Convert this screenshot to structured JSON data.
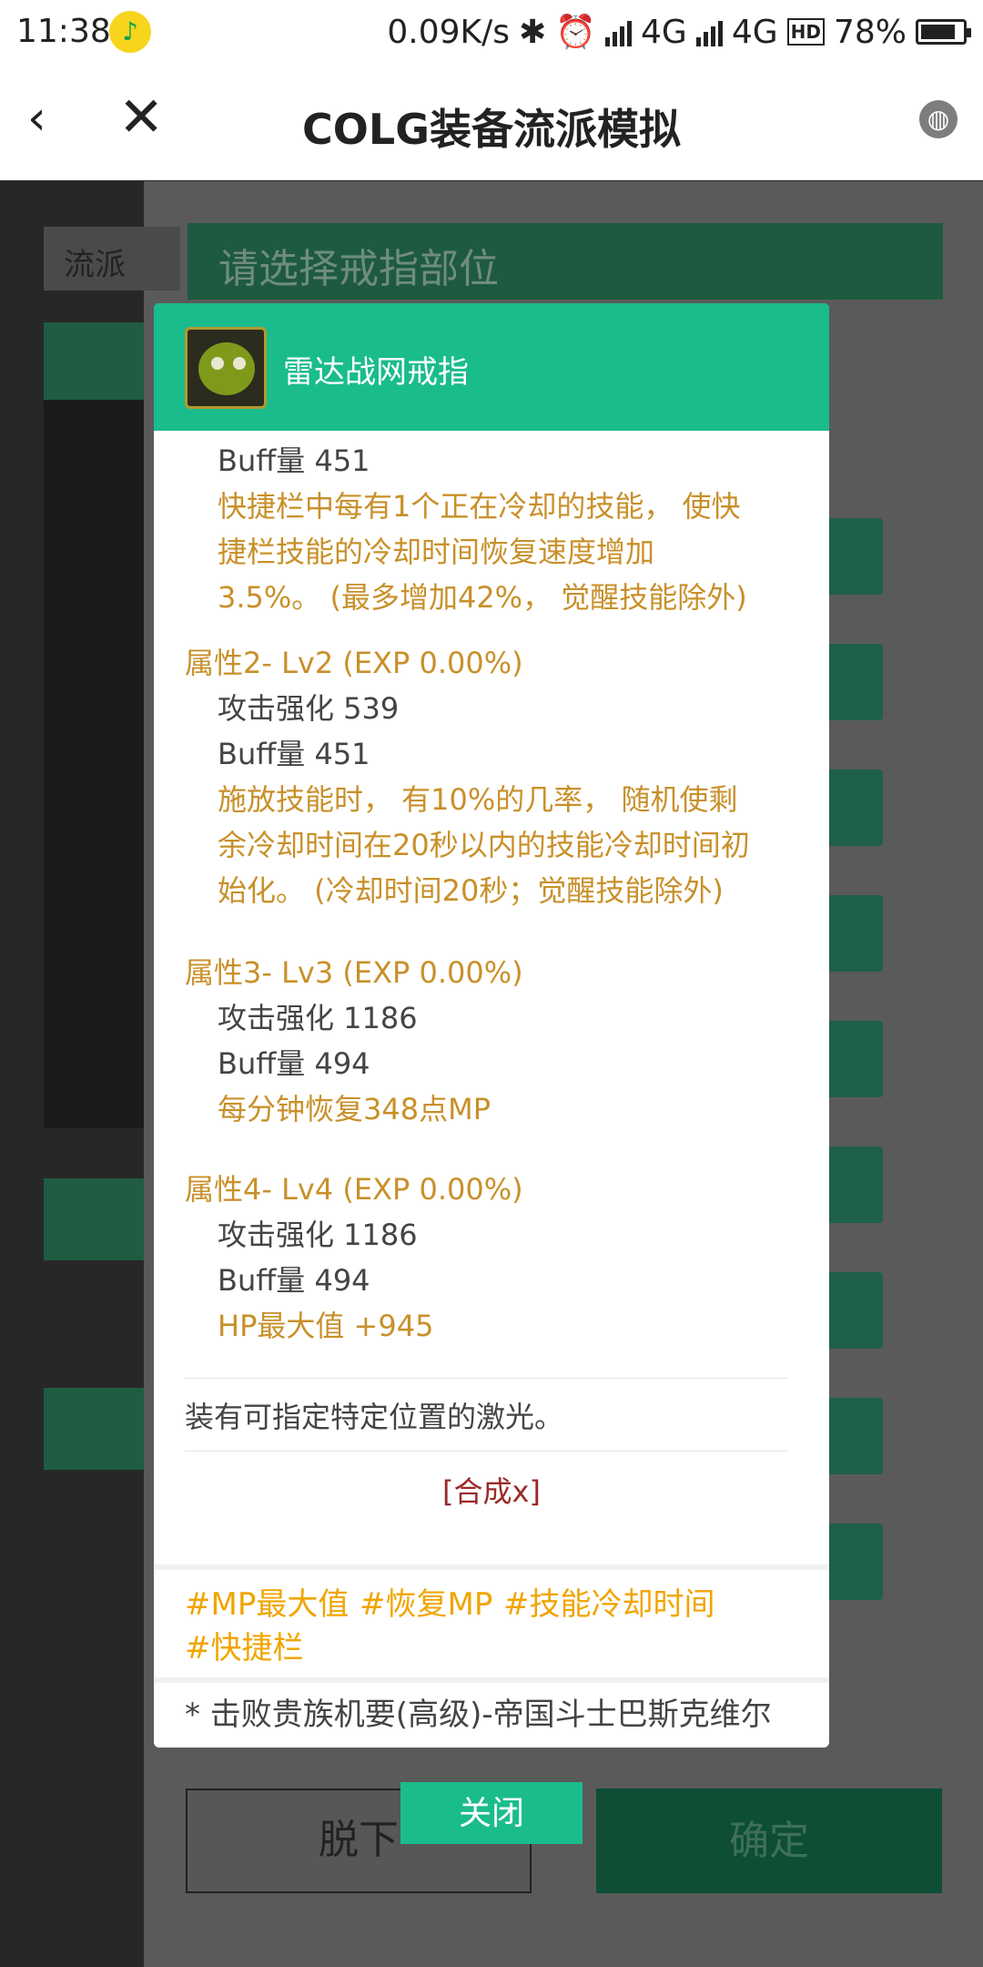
{
  "status_bar": {
    "time": "11:38",
    "network_speed": "0.09K/s",
    "net1": "4G",
    "net2": "4G",
    "hd": "HD",
    "battery": "78%"
  },
  "nav": {
    "title": "COLG装备流派模拟"
  },
  "background": {
    "school_tag": "流派",
    "ring_header": "请选择戒指部位",
    "btn_unequip": "脱下",
    "btn_confirm": "确定"
  },
  "modal": {
    "item_name": "雷达战网戒指",
    "lines": {
      "buff0": "Buff量 451",
      "eff0a": "快捷栏中每有1个正在冷却的技能， 使快",
      "eff0b": "捷栏技能的冷却时间恢复速度增加",
      "eff0c": "3.5%。 (最多增加42%， 觉醒技能除外)",
      "attr2": "属性2- Lv2 (EXP 0.00%)",
      "atk2": "攻击强化 539",
      "buff2": "Buff量 451",
      "eff2a": "施放技能时， 有10%的几率， 随机使剩",
      "eff2b": "余冷却时间在20秒以内的技能冷却时间初",
      "eff2c": "始化。 (冷却时间20秒；觉醒技能除外)",
      "attr3": "属性3- Lv3 (EXP 0.00%)",
      "atk3": "攻击强化 1186",
      "buff3": "Buff量 494",
      "eff3": "每分钟恢复348点MP",
      "attr4": "属性4- Lv4 (EXP 0.00%)",
      "atk4": "攻击强化 1186",
      "buff4": "Buff量 494",
      "eff4": "HP最大值 +945"
    },
    "description": "装有可指定特定位置的激光。",
    "synth": "[合成x]",
    "tags": [
      "#MP最大值",
      "#恢复MP",
      "#技能冷却时间",
      "#快捷栏"
    ],
    "source": "* 击败贵族机要(高级)-帝国斗士巴斯克维尔"
  },
  "close_label": "关闭",
  "colors": {
    "accent": "#1abc8c",
    "attr_text": "#c8902a",
    "tag_text": "#f0a500",
    "synth_text": "#9b2a2a"
  }
}
